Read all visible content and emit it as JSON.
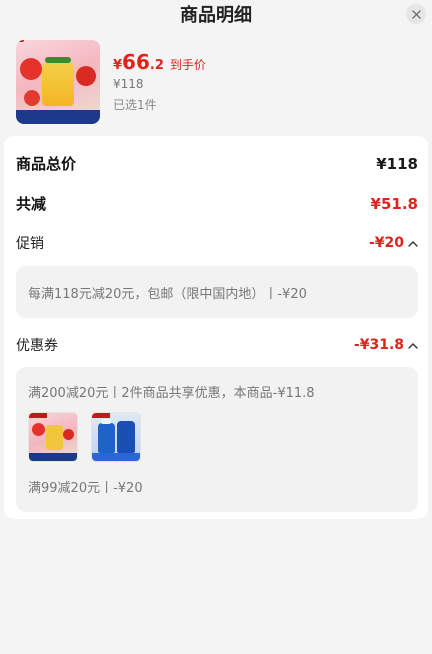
{
  "header": {
    "title": "商品明细"
  },
  "product": {
    "currency": "¥",
    "price_int": "66",
    "price_dec": ".2",
    "price_label": "到手价",
    "original_price": "¥118",
    "selected_qty": "已选1件"
  },
  "summary": {
    "total_label": "商品总价",
    "total_value": "¥118",
    "discount_label": "共减",
    "discount_value": "¥51.8"
  },
  "promotion": {
    "label": "促销",
    "value": "-¥20",
    "detail": "每满118元减20元，包邮（限中国内地）丨-¥20"
  },
  "coupon": {
    "label": "优惠券",
    "value": "-¥31.8",
    "detail_1": "满200减20元丨2件商品共享优惠，本商品-¥11.8",
    "detail_2": "满99减20元丨-¥20"
  },
  "colors": {
    "accent_red": "#e0241b",
    "background": "#f4f4f4",
    "panel": "#f2f2f2"
  },
  "icons": [
    "close-icon",
    "chevron-up-icon"
  ]
}
